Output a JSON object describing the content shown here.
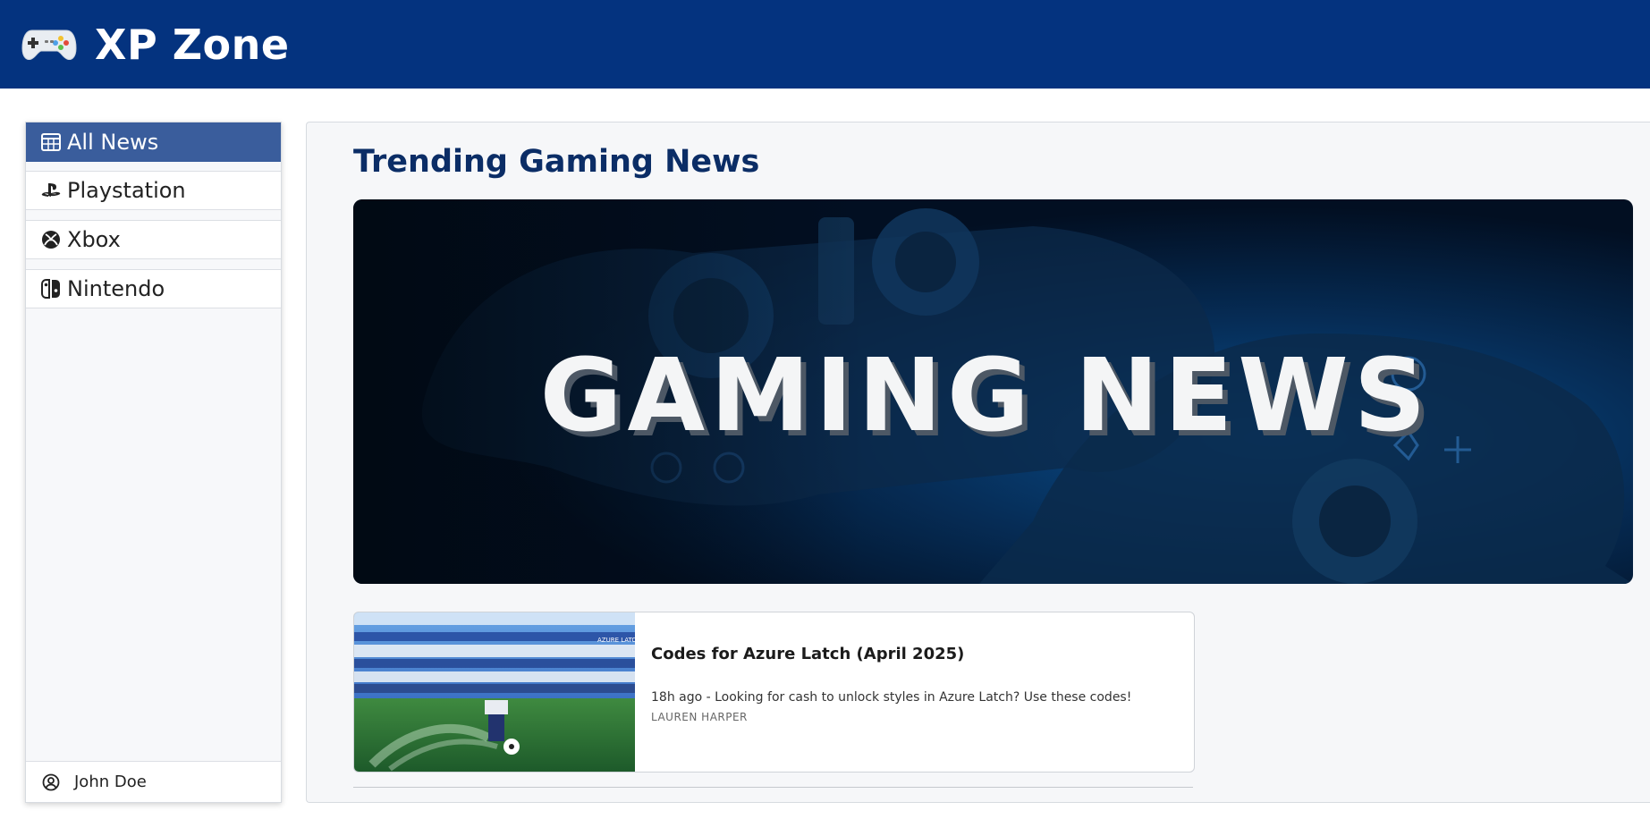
{
  "header": {
    "logo_icon": "gamepad-icon",
    "title": "XP Zone",
    "background": "#04337f"
  },
  "sidebar": {
    "items": [
      {
        "label": "All News",
        "icon": "newspaper-icon",
        "active": true
      },
      {
        "label": "Playstation",
        "icon": "playstation-icon",
        "active": false
      },
      {
        "label": "Xbox",
        "icon": "xbox-icon",
        "active": false
      },
      {
        "label": "Nintendo",
        "icon": "nintendo-switch-icon",
        "active": false
      }
    ],
    "user": {
      "name": "John Doe",
      "icon": "user-circle-icon"
    },
    "active_color": "#3a5d9c"
  },
  "main": {
    "title": "Trending Gaming News",
    "hero": {
      "text": "GAMING NEWS"
    },
    "articles": [
      {
        "title": "Codes for Azure Latch (April 2025)",
        "description": "18h ago - Looking for cash to unlock styles in Azure Latch? Use these codes!",
        "author": "LAUREN HARPER",
        "thumbnail_banner": "AZURE LATCH"
      }
    ]
  }
}
